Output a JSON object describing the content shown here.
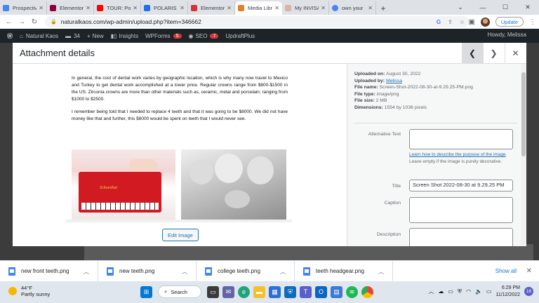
{
  "browser": {
    "tabs": [
      {
        "title": "Prospective",
        "fav": "#4285f4"
      },
      {
        "title": "Elementor",
        "fav": "#92003b"
      },
      {
        "title": "TOUR: Pola",
        "fav": "#ff0000"
      },
      {
        "title": "POLARIS LI",
        "fav": "#1a73e8"
      },
      {
        "title": "Elementor",
        "fav": "#d6323a"
      },
      {
        "title": "Media Libr",
        "fav": "#e67e22"
      },
      {
        "title": "My INVISA",
        "fav": "#d9b3a3"
      },
      {
        "title": "own your",
        "fav": "#4285f4"
      }
    ],
    "active_tab_index": 5,
    "url": "naturalkaos.com/wp-admin/upload.php?item=346662",
    "update_label": "Update"
  },
  "adminbar": {
    "site_name": "Natural Kaos",
    "comments_count": "34",
    "new_label": "New",
    "insights_label": "Insights",
    "wpforms_label": "WPForms",
    "wpforms_badge": "5",
    "seo_label": "SEO",
    "seo_badge": "7",
    "updraft_label": "UpdraftPlus",
    "howdy": "Howdy, Melissa"
  },
  "modal": {
    "title": "Attachment details",
    "doc_paragraphs": [
      "In general, the cost of dental work varies by geographic location, which is why many now travel to Mexico and Turkey to get dental work accomplished at a lower price. Regular crowns range from $800-$1500 in the US. Zirconia crowns are more than other materials such as, ceramic, metal and porcelain; ranging from $1000 to $2500.",
      "I remember being told that I needed to replace 4 teeth and that it was going to be $8000. We did not have money like that and further, this $8000 would be spent on teeth that I would never see."
    ],
    "photo1_brand": "Schoenhut",
    "edit_image_label": "Edit Image",
    "meta": {
      "uploaded_on_label": "Uploaded on:",
      "uploaded_on": "August 30, 2022",
      "uploaded_by_label": "Uploaded by:",
      "uploaded_by": "Melissa",
      "file_name_label": "File name:",
      "file_name": "Screen-Shot-2022-08-30-at-9.29.25-PM.png",
      "file_type_label": "File type:",
      "file_type": "image/png",
      "file_size_label": "File size:",
      "file_size": "2 MB",
      "dimensions_label": "Dimensions:",
      "dimensions": "1554 by 1036 pixels"
    },
    "fields": {
      "alt_label": "Alternative Text",
      "alt_value": "",
      "alt_help_link": "Learn how to describe the purpose of the image",
      "alt_help_text": ". Leave empty if the image is purely decorative.",
      "title_label": "Title",
      "title_value": "Screen Shot 2022-08-30 at 9.29.25 PM",
      "caption_label": "Caption",
      "caption_value": "",
      "description_label": "Description",
      "description_value": ""
    }
  },
  "downloads": {
    "items": [
      "new front teeth.png",
      "new teeth.png",
      "college teeth.png",
      "teeth headgear.png"
    ],
    "show_all": "Show all"
  },
  "taskbar": {
    "temp": "44°F",
    "weather": "Partly sunny",
    "search_label": "Search",
    "time": "6:29 PM",
    "date": "11/12/2022",
    "notif_count": "16"
  }
}
